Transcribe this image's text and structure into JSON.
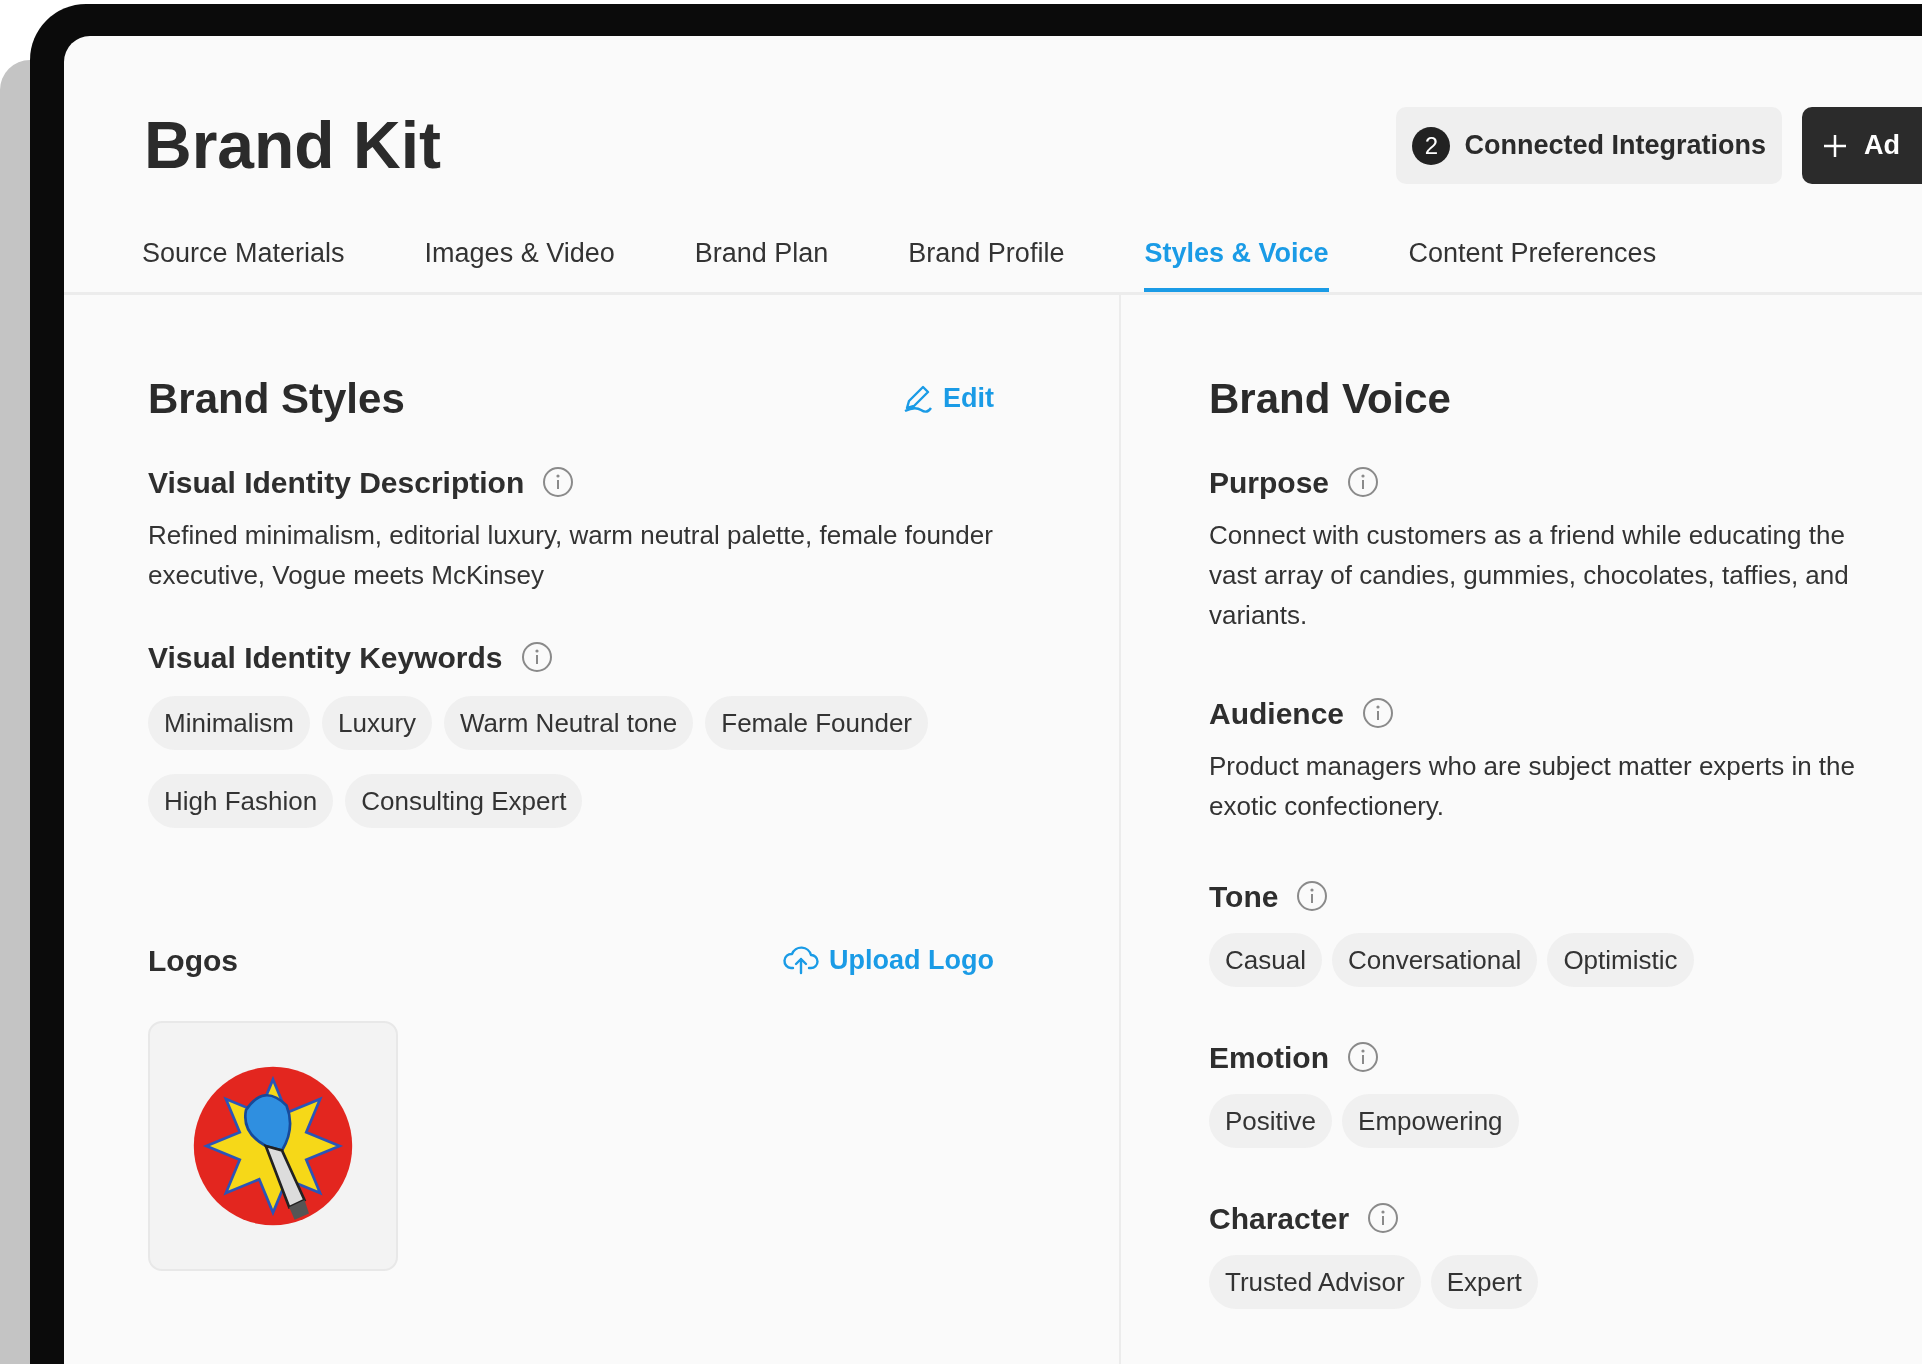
{
  "header": {
    "title": "Brand Kit",
    "integrations": {
      "count": "2",
      "label": "Connected Integrations"
    },
    "add_button": {
      "label": "Ad"
    }
  },
  "tabs": [
    {
      "label": "Source Materials",
      "selected": false
    },
    {
      "label": "Images & Video",
      "selected": false
    },
    {
      "label": "Brand Plan",
      "selected": false
    },
    {
      "label": "Brand Profile",
      "selected": false
    },
    {
      "label": "Styles & Voice",
      "selected": true
    },
    {
      "label": "Content Preferences",
      "selected": false
    }
  ],
  "brand_styles": {
    "title": "Brand Styles",
    "edit": "Edit",
    "description": {
      "label": "Visual Identity Description",
      "text": "Refined minimalism, editorial luxury, warm neutral palette, female founder executive, Vogue meets McKinsey"
    },
    "keywords": {
      "label": "Visual Identity Keywords",
      "tags": [
        "Minimalism",
        "Luxury",
        "Warm Neutral tone",
        "Female Founder",
        "High Fashion",
        "Consulting Expert"
      ]
    },
    "logos": {
      "label": "Logos",
      "upload": "Upload Logo"
    }
  },
  "brand_voice": {
    "title": "Brand Voice",
    "sections": [
      {
        "kind": "text",
        "label": "Purpose",
        "lines": [
          "Connect with customers as a friend while educating the",
          "vast array of candies, gummies, chocolates, taffies, and",
          "variants."
        ]
      },
      {
        "kind": "text",
        "label": "Audience",
        "lines": [
          "Product managers who are subject matter experts in the",
          "exotic confectionery."
        ]
      },
      {
        "kind": "tags",
        "label": "Tone",
        "tags": [
          "Casual",
          "Conversational",
          "Optimistic"
        ]
      },
      {
        "kind": "tags",
        "label": "Emotion",
        "tags": [
          "Positive",
          "Empowering"
        ]
      },
      {
        "kind": "tags",
        "label": "Character",
        "tags": [
          "Trusted Advisor",
          "Expert"
        ]
      }
    ]
  }
}
